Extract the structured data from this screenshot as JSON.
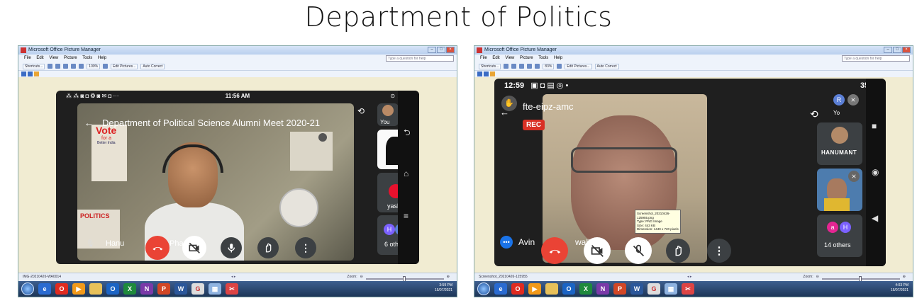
{
  "page": {
    "title": "Department of Politics"
  },
  "app": {
    "window_title": "Microsoft Office Picture Manager",
    "menu": [
      "File",
      "Edit",
      "View",
      "Picture",
      "Tools",
      "Help"
    ],
    "help_placeholder": "Type a question for help",
    "toolbar": {
      "shortcuts": "Shortcuts...",
      "edit_pictures": "Edit Pictures...",
      "auto_correct": "Auto Correct"
    },
    "zoom_label": "Zoom:"
  },
  "left": {
    "zoom_value": "100%",
    "filename": "IMG-20210426-WA0014",
    "tray_time": "3:59 PM",
    "tray_date": "15/07/2021",
    "phone_status_time": "11:56 AM",
    "phone_status_left": "⁂ ⁂ ◙ ◘ ❂ ◙ ✉ ◘ ⋯",
    "phone_status_right": "⊙ ▲ ▭",
    "meeting_title": "Department of Political Science Alumni Meet 2020-21",
    "main_name": "Hanu",
    "main_name_tail": "Pha",
    "self_label": "You",
    "tile_yash": "yash",
    "others_label": "6 others",
    "avatars": [
      "H",
      "R"
    ],
    "poster": {
      "line1": "Vote",
      "line2": "for a",
      "line3": "Better India",
      "side": "POLITICS"
    }
  },
  "right": {
    "zoom_value": "83%",
    "filename": "Screenshot_20210426-125955",
    "tray_time": "4:03 PM",
    "tray_date": "15/07/2021",
    "phone_status_time": "12:59",
    "phone_status_right": "35%",
    "meeting_code": "fte-eipz-amc",
    "rec_label": "REC",
    "main_name_start": "Avin",
    "main_name_end": "wall",
    "tile_hanumant": "HANUMANT",
    "others_label": "14 others",
    "avatars": [
      "a",
      "H"
    ],
    "self_avatar": "R",
    "self_label": "Yo",
    "tooltip": {
      "line1": "Screenshot_20210426-",
      "line2": "125955.png",
      "line3": "Type: PNG Image",
      "line4": "Size: 443 KB",
      "line5": "Dimension: 1440 x 720 pixels"
    }
  },
  "colors": {
    "meet_red": "#ea4335",
    "meet_dark": "#3c4043",
    "avatar_purple": "#7b61ff",
    "avatar_pink": "#e52592"
  }
}
